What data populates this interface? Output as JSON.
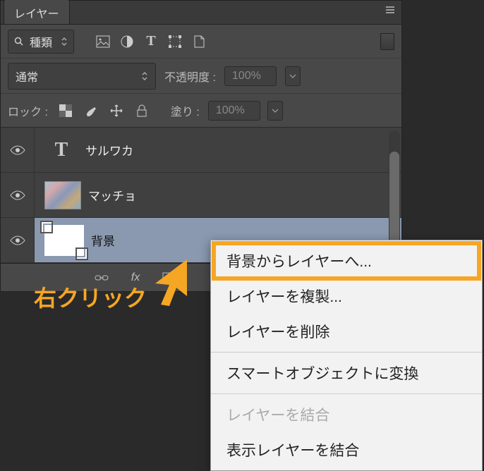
{
  "panel": {
    "tab_label": "レイヤー",
    "filter_label": "種類",
    "blend_mode": "通常",
    "opacity_label": "不透明度 :",
    "opacity_value": "100%",
    "lock_label": "ロック :",
    "fill_label": "塗り :",
    "fill_value": "100%"
  },
  "layers": [
    {
      "name": "サルワカ",
      "type": "text"
    },
    {
      "name": "マッチョ",
      "type": "image"
    },
    {
      "name": "背景",
      "type": "background"
    }
  ],
  "annotation": {
    "right_click": "右クリック"
  },
  "context_menu": {
    "items": [
      {
        "label": "背景からレイヤーへ...",
        "disabled": false,
        "highlight": true
      },
      {
        "label": "レイヤーを複製...",
        "disabled": false
      },
      {
        "label": "レイヤーを削除",
        "disabled": false
      },
      {
        "sep": true
      },
      {
        "label": "スマートオブジェクトに変換",
        "disabled": false
      },
      {
        "sep": true
      },
      {
        "label": "レイヤーを結合",
        "disabled": true
      },
      {
        "label": "表示レイヤーを結合",
        "disabled": false
      }
    ]
  }
}
